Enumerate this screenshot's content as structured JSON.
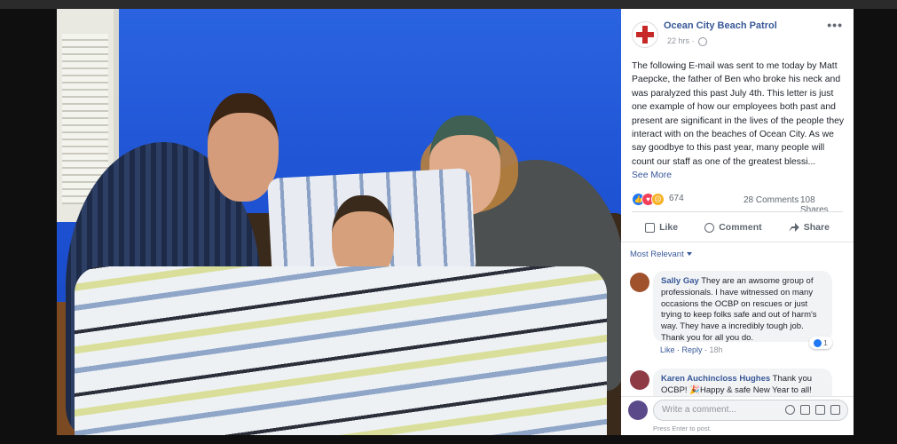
{
  "post": {
    "page_name": "Ocean City Beach Patrol",
    "time": "22 hrs",
    "body": "The following E-mail was sent to me today by Matt Paepcke, the father of Ben who broke his neck and was paralyzed this past July 4th. This letter is just one example of how our employees both past and present are significant in the lives of the people they interact with on the beaches of Ocean City. As we say goodbye to this past year, many people will count our staff as one of the greatest blessi...",
    "see_more": "See More",
    "reaction_count": "674",
    "comments_count": "28 Comments",
    "shares_count": "108 Shares"
  },
  "actions": {
    "like": "Like",
    "comment": "Comment",
    "share": "Share"
  },
  "comments": {
    "filter": "Most Relevant",
    "items": [
      {
        "name": "Sally Gay",
        "text": "They are an awsome group of professionals. I have witnessed on many occasions the OCBP on rescues or just trying to keep folks safe and out of harm's way. They have a incredibly tough job. Thank you for all you do.",
        "like": "Like",
        "reply": "Reply",
        "time": "18h",
        "reactions": "1"
      },
      {
        "name": "Karen Auchincloss Hughes",
        "text": "Thank you OCBP! 🎉Happy & safe New Year to all! Wishing Ben all the best!"
      }
    ]
  },
  "composer": {
    "placeholder": "Write a comment...",
    "hint": "Press Enter to post."
  },
  "colors": {
    "link": "#385898",
    "text": "#1d2129",
    "muted": "#90949c",
    "wall": "#1e4fc7"
  },
  "icons": [
    "more-icon",
    "globe-icon",
    "like-icon",
    "comment-icon",
    "share-icon",
    "emoji-icon",
    "camera-icon",
    "gif-icon",
    "sticker-icon"
  ]
}
